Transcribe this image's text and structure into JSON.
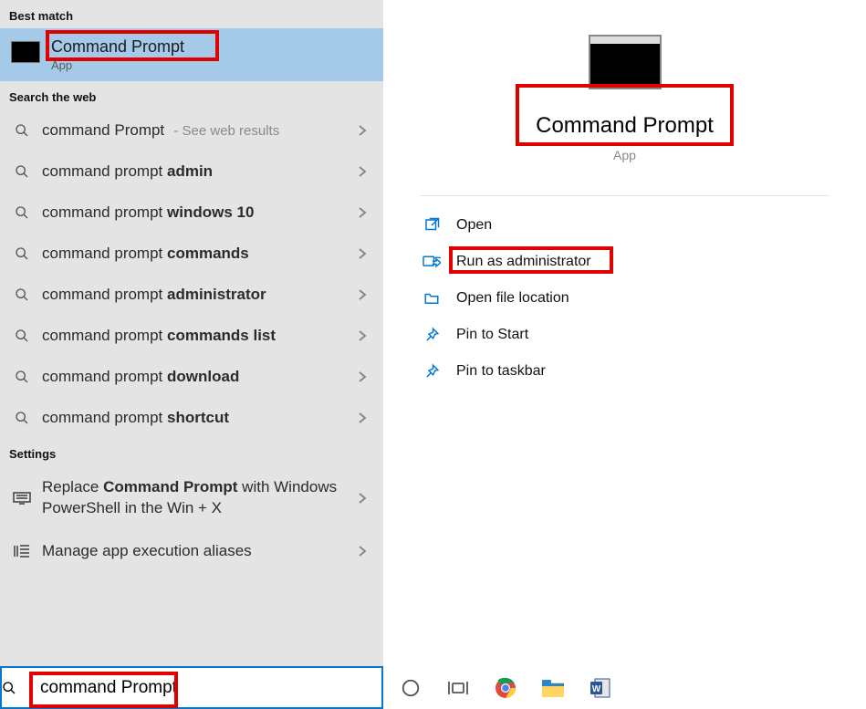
{
  "left": {
    "best_match_label": "Best match",
    "best_match": {
      "title": "Command Prompt",
      "subtitle": "App"
    },
    "search_web_label": "Search the web",
    "web_results": [
      {
        "prefix": "command Prompt",
        "bold": "",
        "trail": "- See web results"
      },
      {
        "prefix": "command prompt ",
        "bold": "admin",
        "trail": ""
      },
      {
        "prefix": "command prompt ",
        "bold": "windows 10",
        "trail": ""
      },
      {
        "prefix": "command prompt ",
        "bold": "commands",
        "trail": ""
      },
      {
        "prefix": "command prompt ",
        "bold": "administrator",
        "trail": ""
      },
      {
        "prefix": "command prompt ",
        "bold": "commands list",
        "trail": ""
      },
      {
        "prefix": "command prompt ",
        "bold": "download",
        "trail": ""
      },
      {
        "prefix": "command prompt ",
        "bold": "shortcut",
        "trail": ""
      }
    ],
    "settings_label": "Settings",
    "settings": [
      {
        "html_pre": "Replace ",
        "html_bold": "Command Prompt",
        "html_post": " with Windows PowerShell in the Win + X"
      },
      {
        "html_pre": "Manage app execution aliases",
        "html_bold": "",
        "html_post": ""
      }
    ]
  },
  "right": {
    "title": "Command Prompt",
    "subtitle": "App",
    "actions": [
      {
        "label": "Open",
        "icon": "open"
      },
      {
        "label": "Run as administrator",
        "icon": "admin"
      },
      {
        "label": "Open file location",
        "icon": "folder"
      },
      {
        "label": "Pin to Start",
        "icon": "pin"
      },
      {
        "label": "Pin to taskbar",
        "icon": "pin"
      }
    ]
  },
  "search": {
    "value": "command Prompt"
  },
  "highlight_color": "#e00000"
}
